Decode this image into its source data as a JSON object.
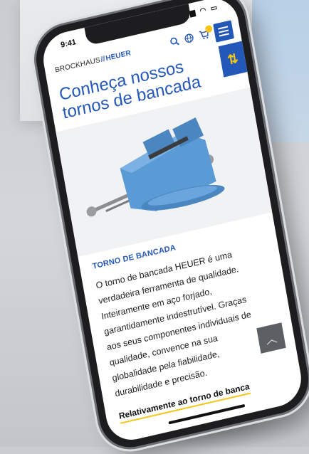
{
  "status": {
    "time": "9:41"
  },
  "brand": {
    "left": "BROCKHAUS",
    "sep": "//",
    "right": "HEUER"
  },
  "header": {
    "cart_count": ""
  },
  "page": {
    "title": "Conheça nossos tornos de bancada",
    "section_heading": "TORNO DE BANCADA",
    "body": "O torno de bancada HEUER é uma verdadeira ferramenta de qualidade. Inteiramente em aço forjado, garantidamente indestrutível. Graças aos seus componentes individuais de qualidade, convence na sua globalidade pela fiabilidade, durabilidade e precisão.",
    "read_more": "Relativamente ao torno de banca"
  },
  "colors": {
    "brand_blue": "#2458b8",
    "accent_yellow": "#f5c518",
    "vise_blue": "#5b9bd5"
  },
  "icons": [
    "search-icon",
    "globe-icon",
    "cart-icon",
    "menu-icon",
    "filter-icon",
    "chevron-up-icon"
  ]
}
